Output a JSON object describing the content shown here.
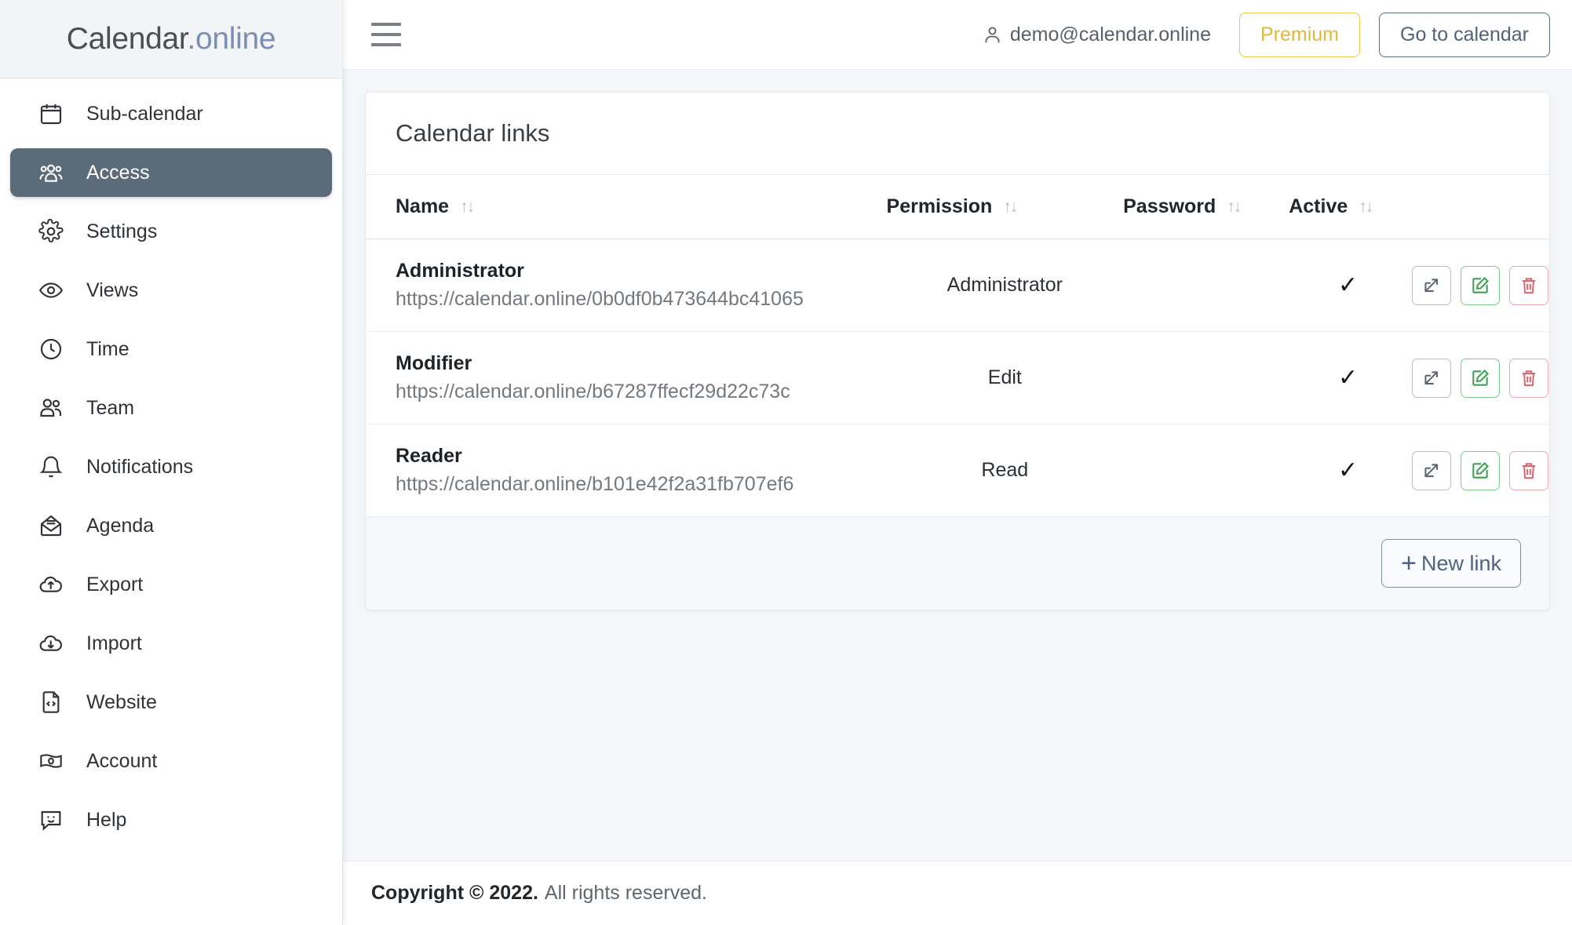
{
  "brand": {
    "name_primary": "Calendar",
    "name_secondary": ".online"
  },
  "sidebar": {
    "items": [
      {
        "label": "Sub-calendar",
        "icon": "calendar-icon",
        "active": false
      },
      {
        "label": "Access",
        "icon": "people-group-icon",
        "active": true
      },
      {
        "label": "Settings",
        "icon": "gear-icon",
        "active": false
      },
      {
        "label": "Views",
        "icon": "eye-icon",
        "active": false
      },
      {
        "label": "Time",
        "icon": "clock-icon",
        "active": false
      },
      {
        "label": "Team",
        "icon": "users-icon",
        "active": false
      },
      {
        "label": "Notifications",
        "icon": "bell-icon",
        "active": false
      },
      {
        "label": "Agenda",
        "icon": "open-envelope-icon",
        "active": false
      },
      {
        "label": "Export",
        "icon": "cloud-upload-icon",
        "active": false
      },
      {
        "label": "Import",
        "icon": "cloud-download-icon",
        "active": false
      },
      {
        "label": "Website",
        "icon": "code-file-icon",
        "active": false
      },
      {
        "label": "Account",
        "icon": "banknote-icon",
        "active": false
      },
      {
        "label": "Help",
        "icon": "smiley-chat-icon",
        "active": false
      }
    ]
  },
  "topbar": {
    "menu_icon": "hamburger-icon",
    "user_icon": "person-icon",
    "user_email": "demo@calendar.online",
    "premium_label": "Premium",
    "calendar_label": "Go to calendar"
  },
  "card": {
    "title": "Calendar links",
    "columns": [
      {
        "label": "Name",
        "sort_icon": "sort-arrows-icon"
      },
      {
        "label": "Permission",
        "sort_icon": "sort-arrows-icon"
      },
      {
        "label": "Password",
        "sort_icon": "sort-arrows-icon"
      },
      {
        "label": "Active",
        "sort_icon": "sort-arrows-icon"
      }
    ],
    "rows": [
      {
        "name": "Administrator",
        "url": "https://calendar.online/0b0df0b473644bc41065",
        "permission": "Administrator",
        "password": "",
        "active": "✓",
        "actions": [
          "external-link-icon",
          "edit-pencil-icon",
          "trash-delete-icon"
        ]
      },
      {
        "name": "Modifier",
        "url": "https://calendar.online/b67287ffecf29d22c73c",
        "permission": "Edit",
        "password": "",
        "active": "✓",
        "actions": [
          "external-link-icon",
          "edit-pencil-icon",
          "trash-delete-icon"
        ]
      },
      {
        "name": "Reader",
        "url": "https://calendar.online/b101e42f2a31fb707ef6",
        "permission": "Read",
        "password": "",
        "active": "✓",
        "actions": [
          "external-link-icon",
          "edit-pencil-icon",
          "trash-delete-icon"
        ]
      }
    ],
    "new_link_plus": "+",
    "new_link_label": "New link"
  },
  "footer": {
    "bold": "Copyright © 2022.",
    "rest": "All rights reserved."
  },
  "colors": {
    "accent_slate": "#5c6b79",
    "brand_blue": "#7b8fb5",
    "premium_gold": "#e2b83c",
    "edit_green": "#3fa052",
    "delete_red": "#d96a74",
    "page_bg": "#f4f6f9"
  }
}
